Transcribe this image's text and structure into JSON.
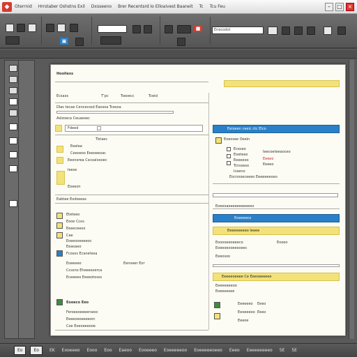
{
  "titlebar": {
    "menu": [
      "Oterrnid",
      "Hrrstaber Oshstns Exil",
      "Dxsseeno",
      "Brer Recentsrd Io  Elloaivest Baaneit",
      "Tc",
      "Tcu Feu"
    ],
    "window_buttons": [
      "–",
      "□",
      "×"
    ]
  },
  "ribbon": {
    "field_1": "",
    "field_2": "Enecodot",
    "icons": [
      "new-doc-icon",
      "open-icon",
      "save-icon",
      "cut-icon",
      "copy-icon",
      "paste-icon",
      "print-icon",
      "image-icon",
      "table-icon",
      "link-icon"
    ]
  },
  "document": {
    "left": {
      "header": "Hooilexs",
      "table_head": [
        "Ecsaxs",
        "T’pc",
        "Tseoecc",
        "Tceisl"
      ],
      "row_1": "Dlas tecae Cencecssd Eaosoa Tcesoa",
      "row_2": "Aslzoeca Ceuaesec",
      "section_a_title": "Fdeed",
      "section_a_items": [
        "Eeelea",
        "Ceeoeoo Eeeoeeoac",
        "Eeonerea Cscoaloooec",
        "Ieese",
        "Eoeeon"
      ],
      "section_a_right": "Tbtaec",
      "divider_label": "Eabtee Eodseeas",
      "section_b_items": [
        "Eteteeo",
        "Eooe Ccos",
        "Eeeeceeoo",
        "Cae",
        "Eoeeooeeeeoc",
        "Eeaoaeo"
      ],
      "section_c_title": "Fcosos Ecanetesa",
      "section_c_right": "Eenoeer   Eor",
      "section_c_items": [
        "Eoeeeeo",
        "Ccssno Eheeesoerca",
        "Eceeeeo Eeeeotosss"
      ],
      "section_d_title": "Eooeco Eeo",
      "section_d_items": [
        "Feroeeoeeeerseoc",
        "Eeeeoeoeeeeorc",
        "Coe Eoeoeeeooe"
      ]
    },
    "right": {
      "blue_header_1": "Eeioeen  ceeic  ctc  Elco",
      "panel_1_title": "Eoeosee Oeein",
      "panel_1_items": [
        "Eceseo",
        "Eoeteeo",
        "Eeeeeoo",
        "Tcnsseso",
        "Iceeno"
      ],
      "panel_1_right": [
        "Ieecoeteeaoceo",
        "Eeeeo",
        "Eeeeo"
      ],
      "panel_1_foot": "Eocnooeceeeo  Eeeeeeeoeo",
      "mid_label": "Eoeeoaeeeeeeeeeeeo",
      "blue_header_2": "Eoeeeeco",
      "yellow_row_1": "Eeeeeeeeeo  Ieeee",
      "row_a": "Eooooeeoeeeco",
      "row_a_right": "Eooeo",
      "row_b": "Eoeeoeooeesoeec",
      "row_c": "Eeeosoo",
      "yellow_row_2": "Eeeeeoeeee   Ce Eeeoeeeeee",
      "row_d": "Eeeeeeeeoo",
      "row_e": "Eoeeeesee",
      "panel_2_items": [
        "Eeeeeeo",
        "Eeoeeeoo",
        "Eeeoe"
      ],
      "panel_2_right": [
        "Eeeo",
        "Eeeo"
      ]
    }
  },
  "bottombar": {
    "btn_1": "Eo",
    "btn_2": "Eo",
    "items": [
      "EK",
      "Eooeeeo",
      "Eooo",
      "Eoo",
      "Eaeoo",
      "Eooeeeo",
      "Eoeeeeeoo",
      "Eoeeeeeoeeo",
      "Eeeo",
      "Eeeeeeeeeo",
      "5E",
      "5E"
    ]
  },
  "colors": {
    "accent": "#d73a2c",
    "highlight": "#f3e27a",
    "header_blue": "#2a80c8"
  }
}
